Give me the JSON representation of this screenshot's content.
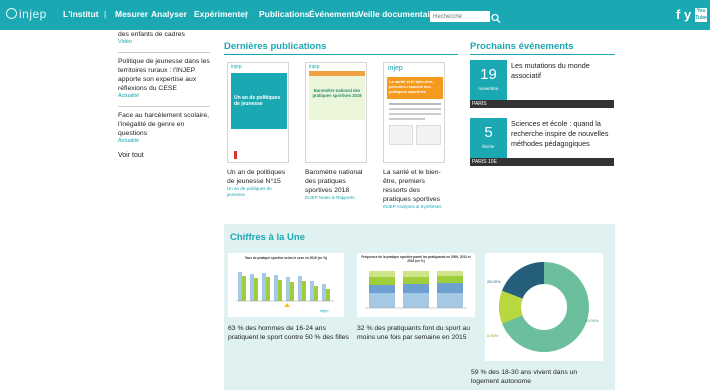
{
  "nav": {
    "logo": "injep",
    "items": [
      "L'institut",
      "Mesurer",
      "Analyser",
      "Expérimenter",
      "Publications",
      "Événements",
      "Veille documentaire"
    ],
    "search_placeholder": "Recherche",
    "social_facebook": "f",
    "social_twitter": "y",
    "social_youtube": "You Tube"
  },
  "left_column": {
    "items": [
      {
        "text": "des enfants de cadres",
        "tag": "Vidéo"
      },
      {
        "text": "Politique de jeunesse dans les territoires ruraux : l'INJEP apporte son expertise aux réflexions du CESE",
        "tag": "Actualité"
      },
      {
        "text": "Face au harcèlement scolaire, l'inégalité de genre en questions",
        "tag": "Actualité"
      }
    ],
    "voir_tout": "Voir tout"
  },
  "publications": {
    "heading": "Dernières publications",
    "items": [
      {
        "title": "Un an de politiques de jeunesse N°15",
        "sub": "Un an de politiques de jeunesse",
        "cover_logo": "injep",
        "cover_heading": "Un an de politiques de jeunesse"
      },
      {
        "title": "Baromètre national des pratiques sportives 2018",
        "sub": "INJEP Notes & Rapports",
        "cover_logo": "injep",
        "cover_heading": "Baromètre national des pratiques sportives 2018"
      },
      {
        "title": "La santé et le bien-être, premiers ressorts des pratiques sportives",
        "sub": "INJEP Analyses & Synthèses",
        "cover_logo": "injep",
        "cover_heading": "La santé et le bien-être, premiers ressorts des pratiques sportives"
      }
    ]
  },
  "events": {
    "heading": "Prochains événements",
    "items": [
      {
        "day": "19",
        "month": "novembre",
        "text": "Les mutations du monde associatif",
        "place": "PARIS"
      },
      {
        "day": "5",
        "month": "février",
        "text": "Sciences et école : quand la recherche inspire de nouvelles méthodes pédagogiques",
        "place": "PARIS 10E"
      }
    ]
  },
  "chiffres": {
    "heading": "Chiffres à la Une",
    "figures": [
      {
        "chart_title": "Taux de pratique sportive selon le sexe en 2015 (en %)",
        "caption": "63 % des hommes de 16-24 ans pratiquent le sport contre 50 % des filles",
        "logo": "injep"
      },
      {
        "chart_title": "Fréquence de la pratique sportive parmi les pratiquants en 2009, 2013 et 2015 (en %)",
        "caption": "32 % des pratiquants font du sport au moins une fois par semaine en 2015"
      },
      {
        "caption": "59 % des 18-30 ans vivent dans un logement autonome",
        "labels": [
          "28.00%",
          "8.00%",
          "59.00%"
        ]
      }
    ]
  },
  "colors": {
    "accent": "#1aa8b2",
    "dark_bar": "#333333",
    "band_bg": "#e0f1f2"
  }
}
